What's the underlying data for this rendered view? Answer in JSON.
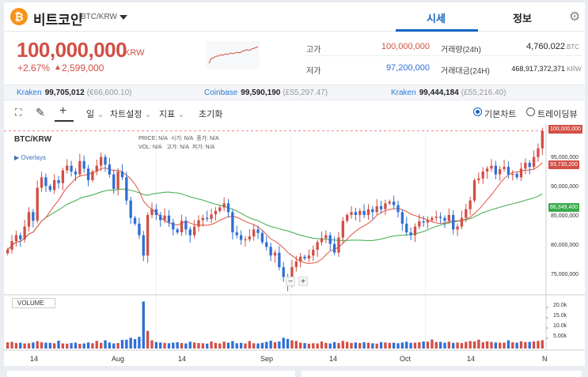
{
  "header": {
    "coin_logo": "₿",
    "coin_name": "비트코인",
    "pair": "BTC/KRW",
    "tabs": [
      {
        "label": "시세",
        "active": true
      },
      {
        "label": "정보",
        "active": false
      }
    ],
    "settings_icon": "gear-icon"
  },
  "price": {
    "current": "100,000,000",
    "unit": "KRW",
    "change_pct": "+2.67%",
    "change_arrow": "▲",
    "change_abs": "2,599,000",
    "color": "#d24f45"
  },
  "stats": {
    "high_label": "고가",
    "high_value": "100,000,000",
    "low_label": "저가",
    "low_value": "97,200,000",
    "vol_label": "거래량(24h)",
    "vol_value": "4,760.022",
    "vol_unit": "BTC",
    "amt_label": "거래대금(24H)",
    "amt_value": "468,917,372,371",
    "amt_unit": "KRW"
  },
  "exchanges": [
    {
      "name": "Kraken",
      "value": "99,705,012",
      "fx": "(€66,600.10)"
    },
    {
      "name": "Coinbase",
      "value": "99,590,190",
      "fx": "(£55,297.47)"
    },
    {
      "name": "Kraken",
      "value": "99,444,184",
      "fx": "(£55,216.40)"
    }
  ],
  "toolbar": {
    "interval": "일",
    "chart_settings": "차트설정",
    "indicators": "지표",
    "reset": "초기화",
    "basic_chart": "기본차트",
    "tradingview": "트레이딩뷰"
  },
  "chart": {
    "title": "BTC/KRW",
    "overlays": "▶ Overlays",
    "legend_row1": [
      "PRICE:",
      "N/A",
      "시가:",
      "N/A",
      "종가:",
      "N/A"
    ],
    "legend_row2": [
      "VOL:",
      "N/A",
      "고가:",
      "N/A",
      "저가:",
      "N/A"
    ],
    "volume_label": "VOLUME",
    "zoom_out": "−",
    "zoom_in": "+"
  },
  "chart_data": {
    "type": "candlestick",
    "y_ticks": [
      "95,000,000",
      "90,000,000",
      "85,000,000",
      "80,000,000",
      "75,000,000"
    ],
    "price_tags": [
      {
        "label": "100,000,000",
        "color": "#d24f45"
      },
      {
        "label": "93,730,200",
        "color": "#d24f45"
      },
      {
        "label": "86,349,400",
        "color": "#3aaa4a"
      }
    ],
    "volume_ticks": [
      "20.0k",
      "15.0k",
      "10.0k",
      "5.00k"
    ],
    "x_labels": [
      "14",
      "Aug",
      "14",
      "Sep",
      "14",
      "Oct",
      "14",
      "N"
    ],
    "ylim": [
      72000000,
      100500000
    ],
    "up_color": "#d24f45",
    "down_color": "#2f6fd6",
    "ma_fast_color": "#e0533f",
    "ma_slow_color": "#3aaa4a",
    "closes": [
      79.5,
      81,
      82,
      81.3,
      83.5,
      86,
      84.5,
      90.2,
      92,
      90.5,
      89.8,
      91.5,
      91,
      93.2,
      94,
      93,
      92.5,
      94.8,
      93.5,
      91.5,
      93,
      94,
      95.5,
      94.2,
      92.5,
      90,
      93,
      92,
      88,
      85,
      84,
      82,
      78.5,
      85.5,
      86.5,
      85.5,
      84.6,
      85.4,
      84.2,
      83,
      82.5,
      84.5,
      83,
      82,
      83.5,
      84.6,
      85,
      84.8,
      85.6,
      86.2,
      86.8,
      87.5,
      86,
      82.5,
      82,
      81.2,
      81.3,
      81.8,
      83,
      82.4,
      80.8,
      80,
      78.5,
      79,
      76.5,
      74.8,
      73.5,
      76.5,
      77.5,
      78.3,
      78,
      78.5,
      79.5,
      80.8,
      81.5,
      82,
      80.5,
      79,
      81.6,
      84.5,
      85.5,
      86,
      85.5,
      86.2,
      85.5,
      86.5,
      86,
      87,
      86.5,
      87.5,
      87.8,
      87.2,
      86,
      84,
      82.5,
      82,
      83.5,
      84.4,
      84.2,
      84.6,
      85,
      85.2,
      85,
      84.5,
      85.5,
      83,
      83.5,
      85,
      86.5,
      88,
      91.5,
      91.8,
      93,
      93.5,
      94,
      92.5,
      93.4,
      93.8,
      92.5,
      92.6,
      92,
      93.5,
      94.5,
      93.8,
      95.5,
      97,
      100
    ],
    "volumes": [
      3.2,
      3.4,
      2.8,
      3,
      2.6,
      2.7,
      3.1,
      3.8,
      3.2,
      3,
      2.9,
      2.7,
      4,
      2.6,
      2.5,
      2.8,
      3,
      2.4,
      2.6,
      3.1,
      2.7,
      3.9,
      2.9,
      4.2,
      3.1,
      2.6,
      2.8,
      4.4,
      4.5,
      5.5,
      4.8,
      6,
      24,
      9,
      4.2,
      3.3,
      3.1,
      2.9,
      2.7,
      3,
      3.2,
      2.8,
      2.6,
      3.5,
      3.1,
      2.8,
      2.7,
      2.5,
      3.6,
      2.9,
      2.6,
      3.5,
      3,
      3.8,
      2.7,
      2.9,
      2.6,
      3.8,
      2.7,
      2.6,
      2.9,
      3.4,
      4,
      3.2,
      3.6,
      5.5,
      4.9,
      4.2,
      3.9,
      3,
      2.8,
      2.5,
      2.7,
      2.6,
      3.6,
      2.9,
      2.6,
      3.3,
      2.8,
      3.9,
      3.4,
      2.9,
      3.1,
      2.8,
      3.2,
      3,
      2.7,
      2.5,
      3.3,
      3.1,
      2.9,
      3,
      2.7,
      3.1,
      3.5,
      2.9,
      3,
      3.2,
      3.6,
      3.5,
      4.6,
      3.3,
      3.4,
      3,
      3.5,
      2.9,
      3.1,
      2.8,
      3.4,
      3.8,
      3.6,
      4.5,
      3.2,
      3.7,
      3.4,
      3.1,
      3,
      3,
      4.2,
      3.2,
      3,
      3.7,
      3.3,
      3.4,
      3.6,
      3.9,
      4.3
    ]
  }
}
